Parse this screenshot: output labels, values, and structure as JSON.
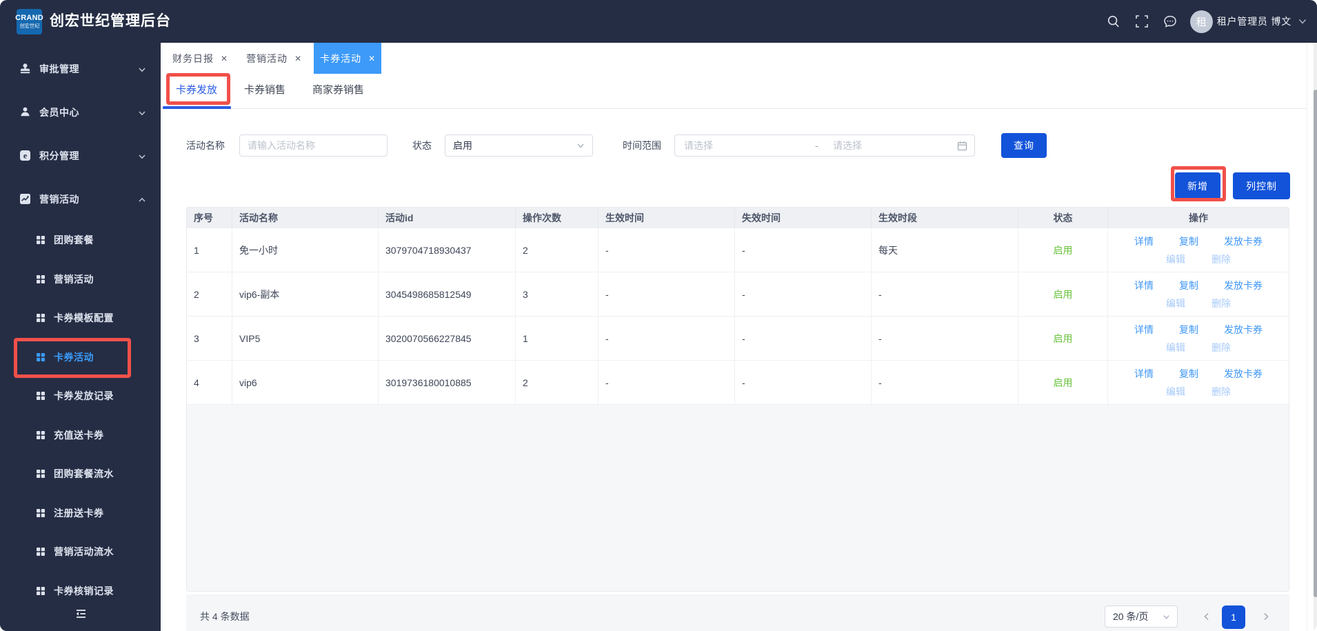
{
  "header": {
    "logo_line1": "CRAND",
    "logo_line2": "创宏世纪",
    "title": "创宏世纪管理后台",
    "user": {
      "avatar_char": "租",
      "name": "租户管理员 博文"
    }
  },
  "sidebar": {
    "items": [
      {
        "label": "审批管理"
      },
      {
        "label": "会员中心"
      },
      {
        "label": "积分管理"
      },
      {
        "label": "营销活动"
      }
    ],
    "sub_items": [
      {
        "label": "团购套餐"
      },
      {
        "label": "营销活动"
      },
      {
        "label": "卡券模板配置"
      },
      {
        "label": "卡券活动",
        "active": true
      },
      {
        "label": "卡券发放记录"
      },
      {
        "label": "充值送卡券"
      },
      {
        "label": "团购套餐流水"
      },
      {
        "label": "注册送卡券"
      },
      {
        "label": "营销活动流水"
      },
      {
        "label": "卡券核销记录"
      }
    ]
  },
  "tabs": [
    {
      "label": "财务日报"
    },
    {
      "label": "营销活动"
    },
    {
      "label": "卡券活动",
      "active": true
    }
  ],
  "subtabs": [
    {
      "label": "卡券发放",
      "active": true
    },
    {
      "label": "卡券销售"
    },
    {
      "label": "商家券销售"
    }
  ],
  "filters": {
    "name_label": "活动名称",
    "name_placeholder": "请输入活动名称",
    "status_label": "状态",
    "status_value": "启用",
    "range_label": "时间范围",
    "range_start_placeholder": "请选择",
    "range_separator": "-",
    "range_end_placeholder": "请选择",
    "query_button": "查询"
  },
  "toolbar": {
    "add_button": "新增",
    "columns_button": "列控制"
  },
  "table": {
    "columns": [
      "序号",
      "活动名称",
      "活动id",
      "操作次数",
      "生效时间",
      "失效时间",
      "生效时段",
      "状态",
      "操作"
    ],
    "rows": [
      {
        "index": "1",
        "name": "免一小时",
        "id": "3079704718930437",
        "count": "2",
        "start": "-",
        "end": "-",
        "period": "每天",
        "status": "启用"
      },
      {
        "index": "2",
        "name": "vip6-副本",
        "id": "3045498685812549",
        "count": "3",
        "start": "-",
        "end": "-",
        "period": "-",
        "status": "启用"
      },
      {
        "index": "3",
        "name": "VIP5",
        "id": "3020070566227845",
        "count": "1",
        "start": "-",
        "end": "-",
        "period": "-",
        "status": "启用"
      },
      {
        "index": "4",
        "name": "vip6",
        "id": "3019736180010885",
        "count": "2",
        "start": "-",
        "end": "-",
        "period": "-",
        "status": "启用"
      }
    ],
    "row_actions_primary": [
      "详情",
      "复制",
      "发放卡券"
    ],
    "row_actions_secondary": [
      "编辑",
      "删除"
    ]
  },
  "pagination": {
    "total_text": "共 4 条数据",
    "page_size": "20 条/页",
    "current_page": "1"
  },
  "colors": {
    "header_bg": "#252d44",
    "logo_bg": "#1568af",
    "active_tab": "#3d9af8",
    "primary_button": "#1253d9",
    "subtab_active": "#2a5ce4",
    "link": "#3f97f6",
    "link_light": "#a5c9f9",
    "status_enabled": "#67c23a",
    "annotation": "#f1504a",
    "sidebar_active": "#3b9bfa"
  }
}
